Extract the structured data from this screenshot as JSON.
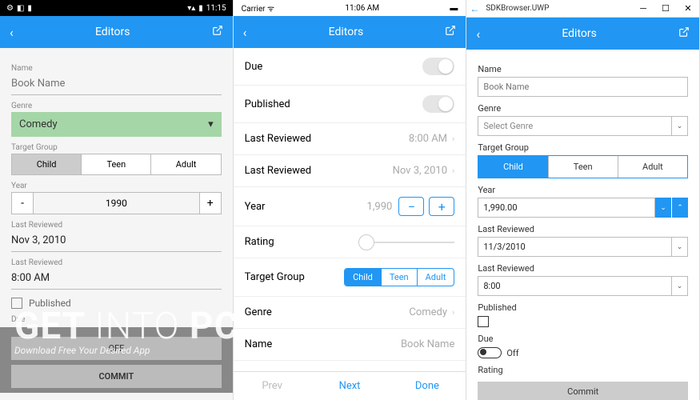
{
  "watermark": {
    "big_get": "GET ",
    "big_into": "INTO ",
    "big_pc": "PC",
    "sub": "Download Free Your Desired App"
  },
  "header": {
    "title": "Editors"
  },
  "android": {
    "status_time": "11:15",
    "labels": {
      "name": "Name",
      "genre": "Genre",
      "target_group": "Target Group",
      "year": "Year",
      "last_reviewed": "Last Reviewed",
      "published": "Published",
      "due": "Due"
    },
    "name_placeholder": "Book Name",
    "genre_value": "Comedy",
    "target": [
      "Child",
      "Teen",
      "Adult"
    ],
    "year_value": "1990",
    "date_value": "Nov 3, 2010",
    "time_value": "8:00 AM",
    "due_off": "OFF",
    "commit": "COMMIT"
  },
  "ios": {
    "status_carrier": "Carrier",
    "status_time": "11:06 AM",
    "rows": {
      "due": "Due",
      "published": "Published",
      "last_reviewed": "Last Reviewed",
      "year": "Year",
      "rating": "Rating",
      "target_group": "Target Group",
      "genre": "Genre",
      "name": "Name"
    },
    "time_value": "8:00 AM",
    "date_value": "Nov 3, 2010",
    "year_value": "1,990",
    "target": [
      "Child",
      "Teen",
      "Adult"
    ],
    "genre_value": "Comedy",
    "name_placeholder": "Book Name",
    "footer": {
      "prev": "Prev",
      "next": "Next",
      "done": "Done"
    }
  },
  "uwp": {
    "window_title": "SDKBrowser.UWP",
    "labels": {
      "name": "Name",
      "genre": "Genre",
      "target_group": "Target Group",
      "year": "Year",
      "last_reviewed": "Last Reviewed",
      "published": "Published",
      "due": "Due",
      "rating": "Rating"
    },
    "name_placeholder": "Book Name",
    "genre_placeholder": "Select Genre",
    "target": [
      "Child",
      "Teen",
      "Adult"
    ],
    "year_value": "1,990.00",
    "date_value": "11/3/2010",
    "time_value": "8:00",
    "due_off": "Off",
    "commit": "Commit"
  }
}
